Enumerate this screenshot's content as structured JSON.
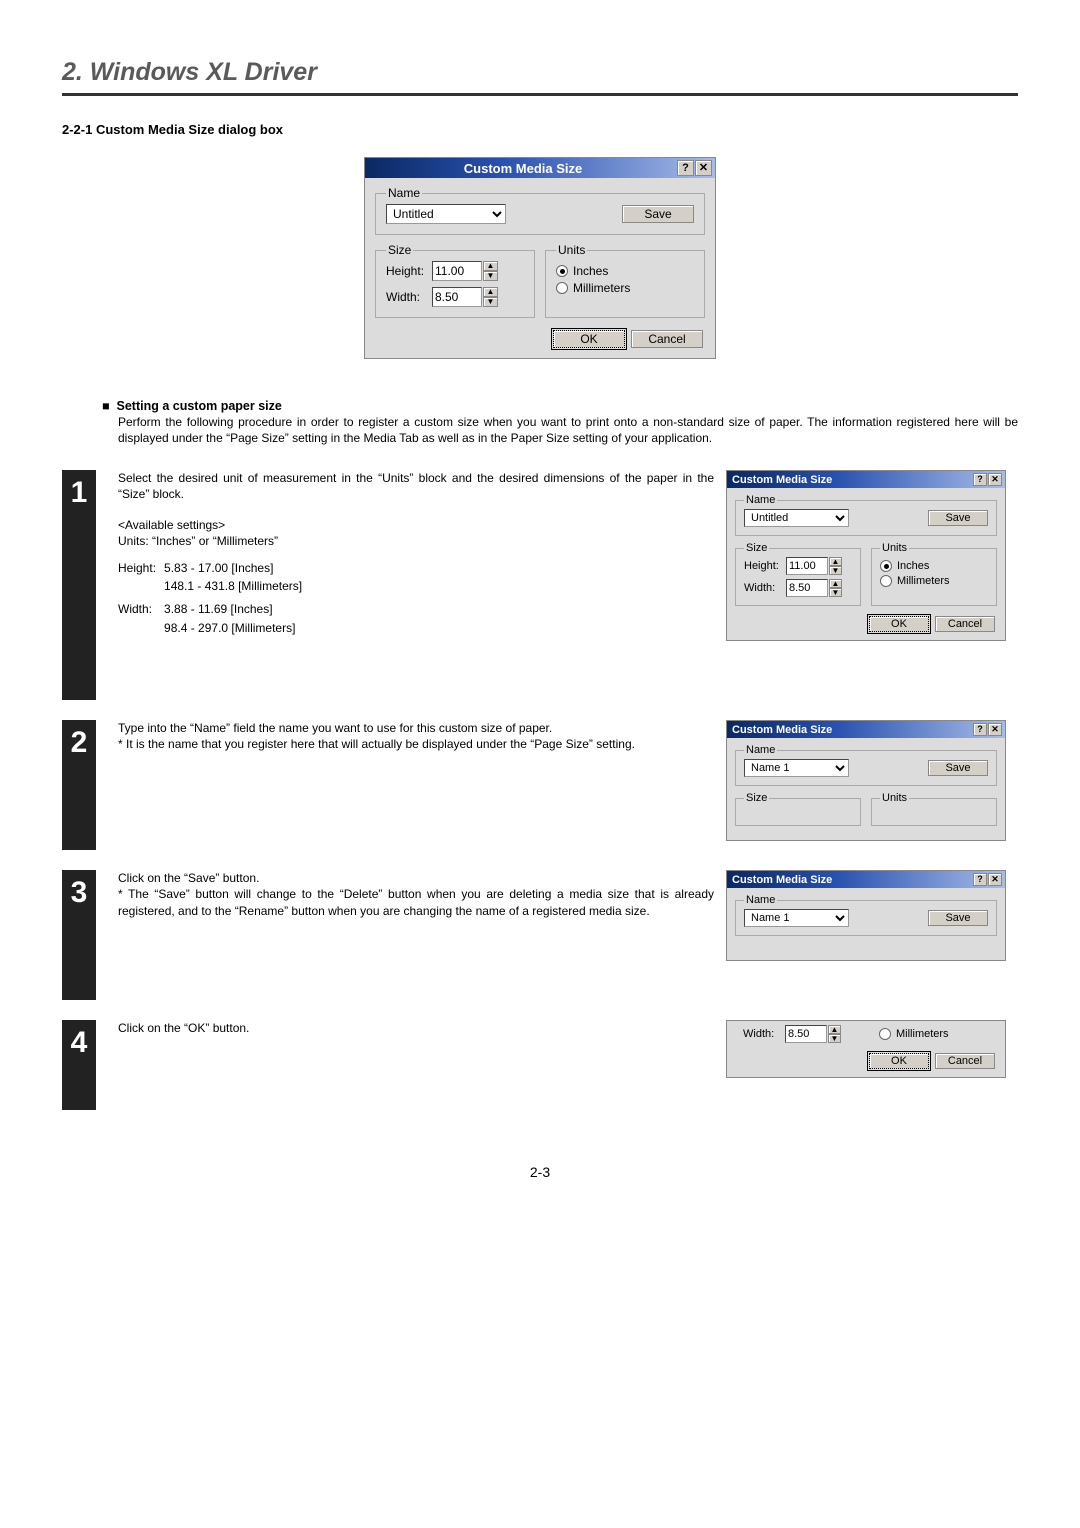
{
  "page": {
    "title": "2. Windows XL Driver",
    "subheading": "2-2-1 Custom Media Size dialog box",
    "page_number": "2-3",
    "section_marker": "■",
    "section_heading": "Setting a custom paper size",
    "section_text": "Perform the following procedure in order to register a custom size when you want to print onto a non-standard size of paper. The information registered here will be displayed under the “Page Size” setting in the Media Tab as well as in the Paper Size setting of your application."
  },
  "dialog": {
    "title": "Custom Media Size",
    "help_glyph": "?",
    "close_glyph": "✕",
    "name_legend": "Name",
    "name_value": "Untitled",
    "save_label": "Save",
    "size_legend": "Size",
    "height_label": "Height:",
    "height_value": "11.00",
    "width_label": "Width:",
    "width_value": "8.50",
    "units_legend": "Units",
    "inches_label": "Inches",
    "mm_label": "Millimeters",
    "ok_label": "OK",
    "cancel_label": "Cancel"
  },
  "steps": {
    "s1": {
      "num": "1",
      "text": "Select the desired unit of measurement in the “Units” block and the desired dimensions of the paper in the “Size” block.",
      "avail_head": "<Available settings>",
      "avail_units": "Units: “Inches” or “Millimeters”",
      "h_lbl": "Height:",
      "h_rng1": "5.83 - 17.00 [Inches]",
      "h_rng2": "148.1 - 431.8 [Millimeters]",
      "w_lbl": "Width:",
      "w_rng1": "3.88 - 11.69 [Inches]",
      "w_rng2": "98.4 - 297.0 [Millimeters]"
    },
    "s2": {
      "num": "2",
      "text": "Type into the “Name” field the name you want to use for this custom size of paper.",
      "note": "* It is the name that you register here that will actually be displayed under the “Page Size” setting.",
      "name_value": "Name 1"
    },
    "s3": {
      "num": "3",
      "text": "Click on the “Save” button.",
      "note": "* The “Save” button will change to the “Delete” button when you are deleting a media size that is already registered, and to the “Rename” button when you are changing the name of a registered media size.",
      "name_value": "Name 1"
    },
    "s4": {
      "num": "4",
      "text": "Click on the “OK” button."
    }
  }
}
